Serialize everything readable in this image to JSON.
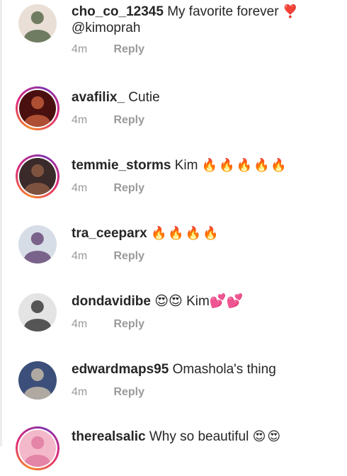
{
  "comments": [
    {
      "username": "cho_co_12345",
      "text": "My favorite forever",
      "emoji": "❣️",
      "line2": "@kimoprah",
      "time": "4m",
      "reply": "Reply",
      "avatar": {
        "ring": false,
        "bg": "#e9dfd6",
        "fg": "#5b6b4e"
      }
    },
    {
      "username": "avafilix_",
      "text": "Cutie",
      "emoji": "",
      "time": "4m",
      "reply": "Reply",
      "avatar": {
        "ring": true,
        "bg": "#4a1010",
        "fg": "#c05a3a"
      }
    },
    {
      "username": "temmie_storms",
      "text": "Kim",
      "emoji": "🔥🔥🔥🔥🔥",
      "time": "4m",
      "reply": "Reply",
      "avatar": {
        "ring": true,
        "bg": "#3a2a2a",
        "fg": "#8a5a44"
      }
    },
    {
      "username": "tra_ceeparx",
      "text": "",
      "emoji": "🔥🔥🔥🔥",
      "time": "4m",
      "reply": "Reply",
      "avatar": {
        "ring": false,
        "bg": "#d7dde6",
        "fg": "#6a4e7a"
      }
    },
    {
      "username": "dondavidibe",
      "text": "😍😍 Kim💕💕",
      "emoji": "",
      "time": "4m",
      "reply": "Reply",
      "avatar": {
        "ring": false,
        "bg": "#e4e4e4",
        "fg": "#3c3c3c"
      }
    },
    {
      "username": "edwardmaps95",
      "text": "Omashola's thing",
      "emoji": "",
      "time": "4m",
      "reply": "Reply",
      "avatar": {
        "ring": false,
        "bg": "#3b4f7a",
        "fg": "#c4b8a8"
      }
    },
    {
      "username": "therealsalic",
      "text": "Why so beautiful",
      "emoji": "😍😍",
      "time": "",
      "reply": "",
      "avatar": {
        "ring": true,
        "bg": "#f3b8c9",
        "fg": "#e07aa0"
      }
    }
  ]
}
